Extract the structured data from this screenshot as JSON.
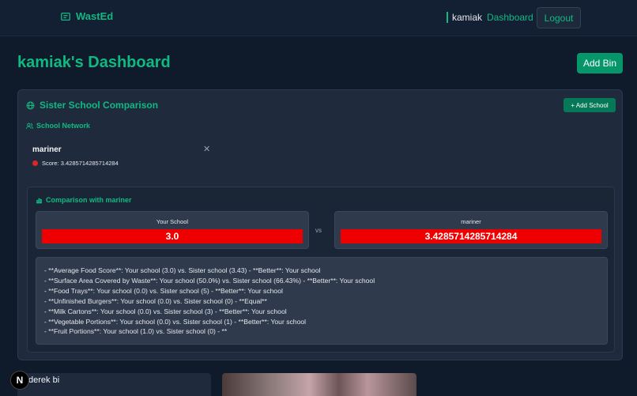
{
  "header": {
    "brand": "WastEd",
    "username": "kamiak",
    "dashboard_link": "Dashboard",
    "logout_label": "Logout"
  },
  "page": {
    "title": "kamiak's Dashboard",
    "add_bin_label": "Add Bin"
  },
  "sister_schools": {
    "title": "Sister School Comparison",
    "add_school_label": "+ Add School",
    "network_label": "School Network",
    "schools": [
      {
        "name": "mariner",
        "score_text": "Score: 3.4285714285714284",
        "status_color": "#dc2626"
      }
    ],
    "close_glyph": "✕"
  },
  "comparison": {
    "title": "Comparison with mariner",
    "your_label": "Your School",
    "your_score": "3.0",
    "vs_label": "vs",
    "sister_label": "mariner",
    "sister_score": "3.4285714285714284",
    "bar_color": "#ef0000",
    "details": [
      "- **Average Food Score**: Your school (3.0) vs. Sister school (3.43) - **Better**: Your school",
      "- **Surface Area Covered by Waste**: Your school (50.0%) vs. Sister school (66.43%) - **Better**: Your school",
      "- **Food Trays**: Your school (0.0) vs. Sister school (5) - **Better**: Your school",
      "- **Unfinished Burgers**: Your school (0.0) vs. Sister school (0) - **Equal**",
      "- **Milk Cartons**: Your school (0.0) vs. Sister school (3) - **Better**: Your school",
      "- **Vegetable Portions**: Your school (0.0) vs. Sister school (1) - **Better**: Your school",
      "- **Fruit Portions**: Your school (1.0) vs. Sister school (0) - **"
    ]
  },
  "bottom": {
    "bin_name": "derek bi",
    "badge_letter": "N"
  },
  "colors": {
    "accent": "#10b981",
    "background": "#0f1a2b",
    "card": "#1f2b3d"
  }
}
